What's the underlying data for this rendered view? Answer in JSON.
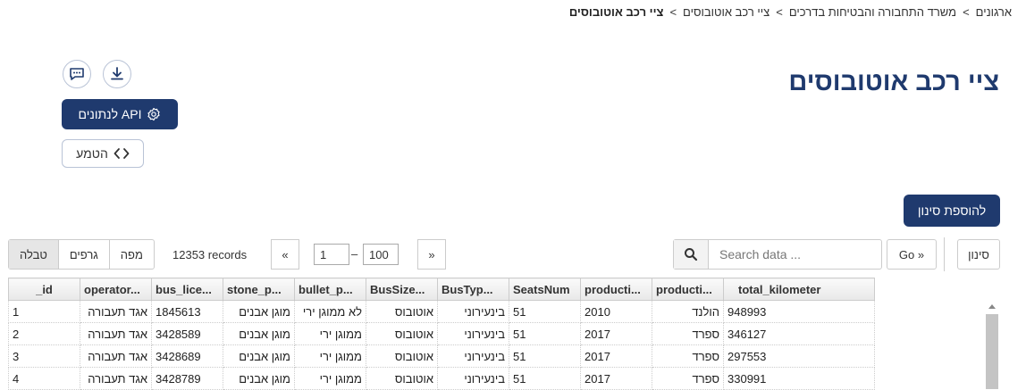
{
  "breadcrumb": {
    "items": [
      "ארגונים",
      "משרד התחבורה והבטיחות בדרכים",
      "ציי רכב אוטובוסים"
    ],
    "current": "ציי רכב אוטובוסים",
    "separator": ">"
  },
  "page": {
    "title": "ציי רכב אוטובוסים"
  },
  "actions": {
    "api_label": "API לנתונים",
    "embed_label": "הטמע",
    "add_filter_label": "להוספת סינון"
  },
  "view_tabs": [
    "טבלה",
    "גרפים",
    "מפה"
  ],
  "records_label": "12353 records",
  "pagination": {
    "prev": "«",
    "next": "»",
    "from": "1",
    "to": "100",
    "dash": "–"
  },
  "search": {
    "placeholder": "Search data ...",
    "go_label": "Go »",
    "filter_label": "סינון"
  },
  "table": {
    "columns": [
      "_id",
      "operator...",
      "bus_lice...",
      "stone_p...",
      "bullet_p...",
      "BusSize...",
      "BusTyp...",
      "SeatsNum",
      "producti...",
      "producti...",
      "total_kilometer"
    ],
    "rows": [
      [
        "1",
        "אגד תעבורה",
        "1845613",
        "מוגן אבנים",
        "לא ממוגן ירי",
        "אוטובוס",
        "בינעירוני",
        "51",
        "2010",
        "הולנד",
        "948993"
      ],
      [
        "2",
        "אגד תעבורה",
        "3428589",
        "מוגן אבנים",
        "ממוגן ירי",
        "אוטובוס",
        "בינעירוני",
        "51",
        "2017",
        "ספרד",
        "346127"
      ],
      [
        "3",
        "אגד תעבורה",
        "3428689",
        "מוגן אבנים",
        "ממוגן ירי",
        "אוטובוס",
        "בינעירוני",
        "51",
        "2017",
        "ספרד",
        "297553"
      ],
      [
        "4",
        "אגד תעבורה",
        "3428789",
        "מוגן אבנים",
        "ממוגן ירי",
        "אוטובוס",
        "בינעירוני",
        "51",
        "2017",
        "ספרד",
        "330991"
      ]
    ]
  },
  "colors": {
    "primary": "#1f3a6e"
  },
  "icons": {
    "comment": "comment-icon",
    "download": "download-icon",
    "api": "gear-icon",
    "embed": "code-icon",
    "search": "search-icon"
  }
}
